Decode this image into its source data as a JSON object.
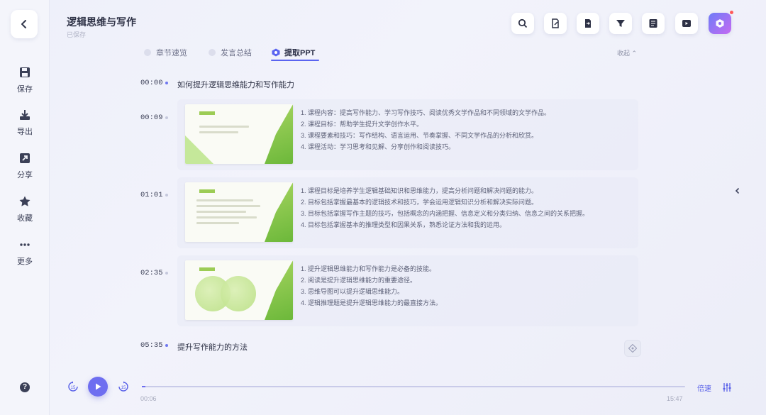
{
  "sidebar": {
    "back_icon": "chevron-left-icon",
    "items": [
      {
        "icon": "save-icon",
        "label": "保存"
      },
      {
        "icon": "export-icon",
        "label": "导出"
      },
      {
        "icon": "share-icon",
        "label": "分享"
      },
      {
        "icon": "star-icon",
        "label": "收藏"
      },
      {
        "icon": "more-icon",
        "label": "更多"
      }
    ],
    "help_icon": "help-icon"
  },
  "header": {
    "title": "逻辑思维与写作",
    "subtitle": "已保存",
    "toolbar": [
      "search-icon",
      "document-edit-icon",
      "document-export-icon",
      "filter-icon",
      "translate-icon",
      "play-video-icon",
      "ai-assistant-icon"
    ]
  },
  "tabs": [
    {
      "label": "章节速览",
      "active": false
    },
    {
      "label": "发言总结",
      "active": false
    },
    {
      "label": "提取PPT",
      "active": true
    }
  ],
  "collapse_label": "收起",
  "sections": [
    {
      "time": "00:00",
      "title": "如何提升逻辑思维能力和写作能力"
    },
    {
      "time": "05:35",
      "title": "提升写作能力的方法"
    }
  ],
  "slides": [
    {
      "time": "00:09",
      "points": [
        "1. 课程内容：提高写作能力、学习写作技巧、阅读优秀文学作品和不同领域的文学作品。",
        "2. 课程目标：帮助学生提升文学创作水平。",
        "3. 课程要素和技巧：写作结构、语言运用、节奏掌握、不同文学作品的分析和欣赏。",
        "4. 课程活动：学习思考和见解、分享创作和阅读技巧。"
      ]
    },
    {
      "time": "01:01",
      "points": [
        "1. 课程目标是培养学生逻辑基础知识和思维能力，提高分析问题和解决问题的能力。",
        "2. 目标包括掌握最基本的逻辑技术和技巧，学会运用逻辑知识分析和解决实际问题。",
        "3. 目标包括掌握写作主题的技巧，包括概念的内涵把握、信息定义和分类归纳、信息之间的关系把握。",
        "4. 目标包括掌握基本的推理类型和因果关系，熟悉论证方法和我的运用。"
      ]
    },
    {
      "time": "02:35",
      "points": [
        "1. 提升逻辑思维能力和写作能力是必备的技能。",
        "2. 阅读是提升逻辑思维能力的重要途径。",
        "3. 思维导图可以提升逻辑思维能力。",
        "4. 逻辑推理题是提升逻辑思维能力的最直接方法。"
      ]
    }
  ],
  "player": {
    "current_time": "00:06",
    "total_time": "15:47",
    "progress": 0.006,
    "speed_label": "倍速",
    "accent": "#6e6ef0"
  }
}
